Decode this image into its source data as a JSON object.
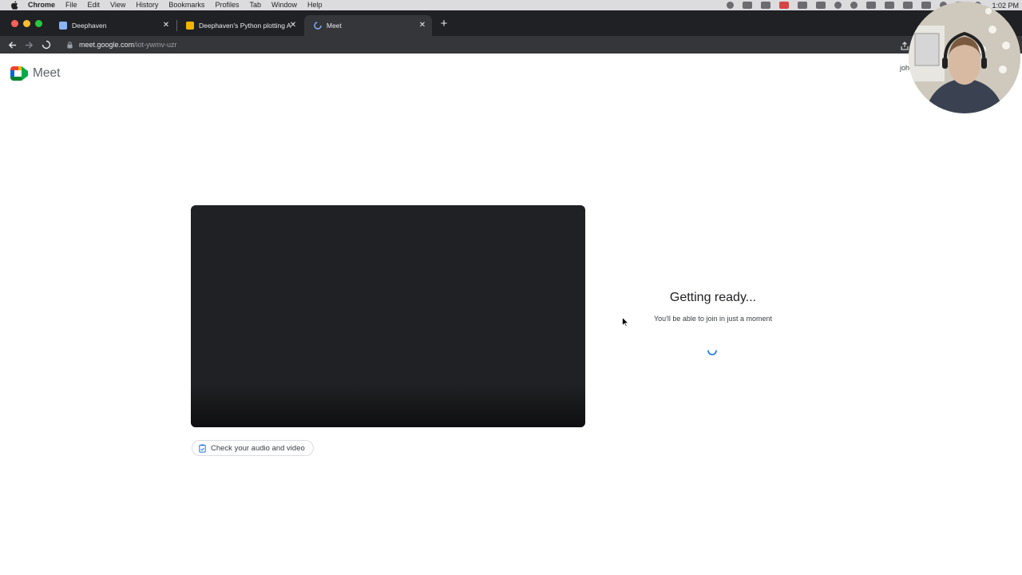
{
  "menubar": {
    "app": "Chrome",
    "items": [
      "File",
      "Edit",
      "View",
      "History",
      "Bookmarks",
      "Profiles",
      "Tab",
      "Window",
      "Help"
    ],
    "clock": "1:02 PM"
  },
  "tabs": [
    {
      "title": "Deephaven",
      "favicon": "deephaven-icon",
      "active": false
    },
    {
      "title": "Deephaven's Python plotting A",
      "favicon": "slides-icon",
      "active": false
    },
    {
      "title": "Meet",
      "favicon": "meet-icon",
      "active": true
    }
  ],
  "toolbar": {
    "url_host": "meet.google.com",
    "url_path": "/iot-ywmv-uzr"
  },
  "page": {
    "logo_text": "Meet",
    "account_text": "joh",
    "preview_color": "#202124",
    "check_button_label": "Check your audio and video",
    "ready_title": "Getting ready...",
    "ready_subtitle": "You'll be able to join in just a moment"
  },
  "colors": {
    "tabstrip": "#202124",
    "active_tab": "#35363a",
    "accent_blue": "#1a73e8",
    "meet_green": "#00832d",
    "meet_yellow": "#ffba00",
    "meet_red": "#ea4335",
    "meet_blue": "#0066da"
  }
}
